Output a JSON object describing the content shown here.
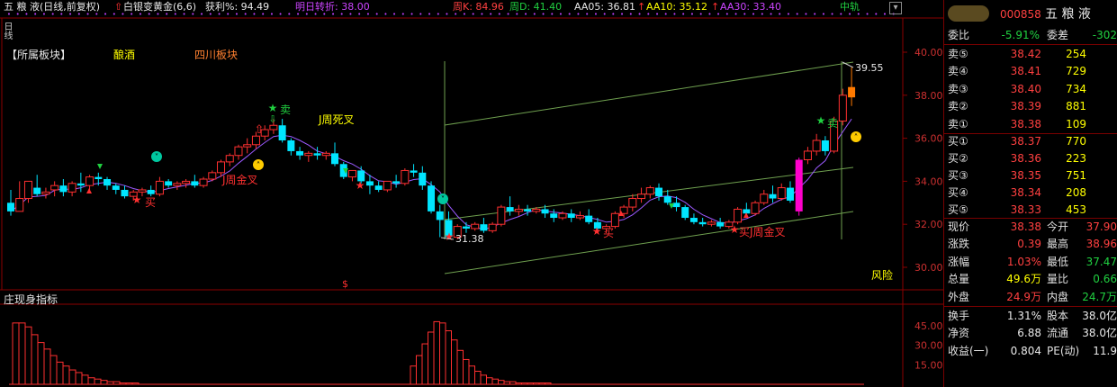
{
  "header": {
    "stock": "五 粮 液(日线,前复权)",
    "indicator": "白银变黄金(6,6)",
    "profit_label": "获利%: 94.49",
    "next_turn": "明日转折: 38.00",
    "weekK": "周K: 84.96",
    "weekD": "周D: 41.40",
    "aa05": "AA05: 36.81",
    "aa10": "AA10: 35.12",
    "aa30": "AA30: 33.40",
    "zhongzhou": "中轨"
  },
  "sector": {
    "label": "【所属板块】",
    "tag1": "酿酒",
    "tag2": "四川板块"
  },
  "annotations": {
    "sell1": "卖",
    "sell2": "卖",
    "buy1": "买",
    "buy2": "买",
    "buy3": "买",
    "jweek_gold1": "J周金叉",
    "jweek_dead": "J周死叉",
    "jweek_gold2": "J周金叉",
    "high_price": "39.55",
    "low_price": "31.38",
    "risk": "风险",
    "dollar": "$"
  },
  "price_axis": [
    "40.00",
    "38.00",
    "36.00",
    "34.00",
    "32.00",
    "30.00"
  ],
  "sub_indicator": {
    "title": "庄现身指标",
    "axis": [
      "45.00",
      "30.00",
      "15.00"
    ]
  },
  "colors": {
    "up": "#ff3030",
    "down": "#00e5ff",
    "channel": "#6fa04f",
    "ma": "#9b59ff",
    "axis_red": "#8b0000",
    "yellow": "#ffff00"
  },
  "quote": {
    "code": "000858",
    "name": "五 粮 液",
    "weibi_label": "委比",
    "weibi": "-5.91%",
    "weicha_label": "委差",
    "weicha": "-302",
    "asks": [
      {
        "label": "卖⑤",
        "price": "38.42",
        "vol": "254"
      },
      {
        "label": "卖④",
        "price": "38.41",
        "vol": "729"
      },
      {
        "label": "卖③",
        "price": "38.40",
        "vol": "734"
      },
      {
        "label": "卖②",
        "price": "38.39",
        "vol": "881"
      },
      {
        "label": "卖①",
        "price": "38.38",
        "vol": "109"
      }
    ],
    "bids": [
      {
        "label": "买①",
        "price": "38.37",
        "vol": "770"
      },
      {
        "label": "买②",
        "price": "38.36",
        "vol": "223"
      },
      {
        "label": "买③",
        "price": "38.35",
        "vol": "751"
      },
      {
        "label": "买④",
        "price": "38.34",
        "vol": "208"
      },
      {
        "label": "买⑤",
        "price": "38.33",
        "vol": "453"
      }
    ],
    "stats": [
      {
        "l1": "现价",
        "v1": "38.38",
        "c1": "red",
        "l2": "今开",
        "v2": "37.90",
        "c2": "red"
      },
      {
        "l1": "涨跌",
        "v1": "0.39",
        "c1": "red",
        "l2": "最高",
        "v2": "38.96",
        "c2": "red"
      },
      {
        "l1": "涨幅",
        "v1": "1.03%",
        "c1": "red",
        "l2": "最低",
        "v2": "37.47",
        "c2": "green"
      },
      {
        "l1": "总量",
        "v1": "49.6万",
        "c1": "yellow",
        "l2": "量比",
        "v2": "0.66",
        "c2": "green"
      },
      {
        "l1": "外盘",
        "v1": "24.9万",
        "c1": "red",
        "l2": "内盘",
        "v2": "24.7万",
        "c2": "green"
      },
      {
        "l1": "换手",
        "v1": "1.31%",
        "c1": "white",
        "l2": "股本",
        "v2": "38.0亿",
        "c2": "white"
      },
      {
        "l1": "净资",
        "v1": "6.88",
        "c1": "white",
        "l2": "流通",
        "v2": "38.0亿",
        "c2": "white"
      },
      {
        "l1": "收益(一)",
        "v1": "0.804",
        "c1": "white",
        "l2": "PE(动)",
        "v2": "11.9",
        "c2": "white"
      }
    ]
  },
  "chart_data": {
    "type": "candlestick",
    "ylim": [
      29.5,
      40.5
    ],
    "candles": [
      [
        33.0,
        33.6,
        32.6,
        32.4
      ],
      [
        32.6,
        34.0,
        33.2,
        32.6
      ],
      [
        33.2,
        33.9,
        34.0,
        33.0
      ],
      [
        33.7,
        34.3,
        33.4,
        33.3
      ],
      [
        33.4,
        33.7,
        33.5,
        33.2
      ],
      [
        33.6,
        34.0,
        33.8,
        33.3
      ],
      [
        33.8,
        34.1,
        33.5,
        33.3
      ],
      [
        33.5,
        34.0,
        33.9,
        33.3
      ],
      [
        33.9,
        34.4,
        33.8,
        33.5
      ],
      [
        33.8,
        34.3,
        34.2,
        33.6
      ],
      [
        34.2,
        34.4,
        34.1,
        33.8
      ],
      [
        34.1,
        34.2,
        33.8,
        33.6
      ],
      [
        33.8,
        33.9,
        33.6,
        33.4
      ],
      [
        33.6,
        33.8,
        33.3,
        33.2
      ],
      [
        33.3,
        33.6,
        33.5,
        33.1
      ],
      [
        33.5,
        33.7,
        33.6,
        33.3
      ],
      [
        33.6,
        33.8,
        33.4,
        33.3
      ],
      [
        33.4,
        34.2,
        34.0,
        33.3
      ],
      [
        34.0,
        34.1,
        33.8,
        33.7
      ],
      [
        33.8,
        34.0,
        33.9,
        33.6
      ],
      [
        33.9,
        34.1,
        34.0,
        33.7
      ],
      [
        34.0,
        34.3,
        33.8,
        33.7
      ],
      [
        33.8,
        34.2,
        34.1,
        33.7
      ],
      [
        34.1,
        34.5,
        34.4,
        34.0
      ],
      [
        34.4,
        35.0,
        34.9,
        34.2
      ],
      [
        34.9,
        35.3,
        35.2,
        34.7
      ],
      [
        35.2,
        35.7,
        35.6,
        35.0
      ],
      [
        35.6,
        36.0,
        35.7,
        35.3
      ],
      [
        35.7,
        36.3,
        36.1,
        35.5
      ],
      [
        36.1,
        36.6,
        36.4,
        35.9
      ],
      [
        36.4,
        36.9,
        36.6,
        36.2
      ],
      [
        36.6,
        36.9,
        35.9,
        35.8
      ],
      [
        35.9,
        36.0,
        35.4,
        35.2
      ],
      [
        35.4,
        35.6,
        35.2,
        35.0
      ],
      [
        35.2,
        35.4,
        35.3,
        34.9
      ],
      [
        35.3,
        35.6,
        35.2,
        35.0
      ],
      [
        35.2,
        35.4,
        35.3,
        35.0
      ],
      [
        35.3,
        35.8,
        34.8,
        34.7
      ],
      [
        34.8,
        34.9,
        34.2,
        34.1
      ],
      [
        34.2,
        34.4,
        34.5,
        34.0
      ],
      [
        34.5,
        34.7,
        34.0,
        33.9
      ],
      [
        34.0,
        34.3,
        33.8,
        33.4
      ],
      [
        33.8,
        34.0,
        33.6,
        33.5
      ],
      [
        33.6,
        33.9,
        34.0,
        33.5
      ],
      [
        34.0,
        34.3,
        33.9,
        33.7
      ],
      [
        33.9,
        34.6,
        34.5,
        33.8
      ],
      [
        34.5,
        34.8,
        34.4,
        34.2
      ],
      [
        34.4,
        34.7,
        33.8,
        33.6
      ],
      [
        33.8,
        34.0,
        32.6,
        32.5
      ],
      [
        32.6,
        32.9,
        32.2,
        31.4
      ],
      [
        32.2,
        32.6,
        31.4,
        31.3
      ],
      [
        31.4,
        32.0,
        31.9,
        31.3
      ],
      [
        31.9,
        32.1,
        31.8,
        31.6
      ],
      [
        31.8,
        32.1,
        32.0,
        31.7
      ],
      [
        32.0,
        32.3,
        31.7,
        31.6
      ],
      [
        31.7,
        32.1,
        32.0,
        31.6
      ],
      [
        32.0,
        32.9,
        32.8,
        31.9
      ],
      [
        32.8,
        33.3,
        32.6,
        32.4
      ],
      [
        32.6,
        32.9,
        32.7,
        32.4
      ],
      [
        32.7,
        32.9,
        32.6,
        32.4
      ],
      [
        32.6,
        32.8,
        32.7,
        32.5
      ],
      [
        32.7,
        32.9,
        32.5,
        32.3
      ],
      [
        32.5,
        32.7,
        32.3,
        32.1
      ],
      [
        32.3,
        32.6,
        32.5,
        32.2
      ],
      [
        32.5,
        32.7,
        32.3,
        32.1
      ],
      [
        32.3,
        32.6,
        32.4,
        32.2
      ],
      [
        32.4,
        32.7,
        32.1,
        32.0
      ],
      [
        32.1,
        32.3,
        31.8,
        31.7
      ],
      [
        31.8,
        32.0,
        31.9,
        31.6
      ],
      [
        31.9,
        32.6,
        32.5,
        31.8
      ],
      [
        32.5,
        32.9,
        32.8,
        32.3
      ],
      [
        32.8,
        33.4,
        33.2,
        32.6
      ],
      [
        33.2,
        33.7,
        33.4,
        33.0
      ],
      [
        33.4,
        33.8,
        33.7,
        33.2
      ],
      [
        33.7,
        33.9,
        33.3,
        33.1
      ],
      [
        33.3,
        33.6,
        33.0,
        32.9
      ],
      [
        33.0,
        33.3,
        32.8,
        32.6
      ],
      [
        32.8,
        32.9,
        32.3,
        32.2
      ],
      [
        32.3,
        32.5,
        32.1,
        32.0
      ],
      [
        32.1,
        32.3,
        32.0,
        31.9
      ],
      [
        32.0,
        32.2,
        32.1,
        31.9
      ],
      [
        32.1,
        32.3,
        31.9,
        31.8
      ],
      [
        31.9,
        32.2,
        32.1,
        31.8
      ],
      [
        32.1,
        32.8,
        32.7,
        32.0
      ],
      [
        32.7,
        33.0,
        32.5,
        32.4
      ],
      [
        32.5,
        33.1,
        33.0,
        32.4
      ],
      [
        33.0,
        33.6,
        33.4,
        32.9
      ],
      [
        33.4,
        33.8,
        33.2,
        33.0
      ],
      [
        33.2,
        33.9,
        33.7,
        33.1
      ],
      [
        33.7,
        34.0,
        33.1,
        33.0
      ],
      [
        32.6,
        35.1,
        35.0,
        32.4
      ],
      [
        35.0,
        35.6,
        35.4,
        34.8
      ],
      [
        35.4,
        36.2,
        35.9,
        35.2
      ],
      [
        35.9,
        36.1,
        35.4,
        35.2
      ],
      [
        35.4,
        37.0,
        36.8,
        35.3
      ],
      [
        36.8,
        38.3,
        38.0,
        36.6
      ],
      [
        37.9,
        39.3,
        38.38,
        37.5
      ]
    ]
  }
}
